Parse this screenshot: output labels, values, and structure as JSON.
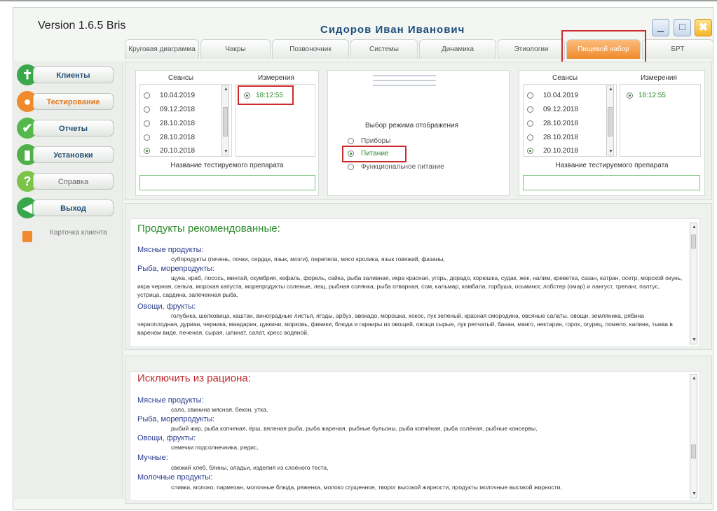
{
  "app": {
    "version": "Version 1.6.5 Bris",
    "user_name": "Сидоров Иван Иванович",
    "window_buttons": {
      "minimize_icon": "minimize-icon",
      "maximize_icon": "maximize-icon",
      "close_icon": "close-icon",
      "close_glyph": "✖"
    }
  },
  "tabs": [
    {
      "label": "Круговая диаграмма",
      "active": false
    },
    {
      "label": "Чакры",
      "active": false
    },
    {
      "label": "Позвоночник",
      "active": false
    },
    {
      "label": "Системы",
      "active": false
    },
    {
      "label": "Динамика",
      "active": false
    },
    {
      "label": "Этиологии",
      "active": false
    },
    {
      "label": "Пищевой набор",
      "active": true
    },
    {
      "label": "БРТ",
      "active": false
    }
  ],
  "sidebar": {
    "items": [
      {
        "label": "Клиенты",
        "icon": "person-icon",
        "icon_color": "#3aa84a",
        "glyph": "✝"
      },
      {
        "label": "Тестирование",
        "icon": "user-icon",
        "icon_color": "#f08a2c",
        "glyph": "●"
      },
      {
        "label": "Отчеты",
        "icon": "checkmark-icon",
        "icon_color": "#55b84a",
        "glyph": "✔"
      },
      {
        "label": "Установки",
        "icon": "chart-icon",
        "icon_color": "#4fb04a",
        "glyph": "▮"
      },
      {
        "label": "Справка",
        "icon": "question-icon",
        "icon_color": "#7cc34a",
        "glyph": "?"
      },
      {
        "label": "Выход",
        "icon": "exit-arrow-icon",
        "icon_color": "#3aa84a",
        "glyph": "◀"
      }
    ],
    "card_label": "Карточка клиента"
  },
  "left_panel": {
    "sessions_header": "Сеансы",
    "measurements_header": "Измерения",
    "sessions": [
      {
        "date": "10.04.2019",
        "selected": false
      },
      {
        "date": "09.12.2018",
        "selected": false
      },
      {
        "date": "28.10.2018",
        "selected": false
      },
      {
        "date": "28.10.2018",
        "selected": false
      },
      {
        "date": "20.10.2018",
        "selected": true
      }
    ],
    "measurement": "18:12:55",
    "drug_caption": "Название тестируемого препарата",
    "drug_value": ""
  },
  "mode_panel": {
    "title": "Выбор режима отображения",
    "options": [
      {
        "label": "Приборы",
        "selected": false
      },
      {
        "label": "Питание",
        "selected": true
      },
      {
        "label": "Функциональное питание",
        "selected": false
      }
    ]
  },
  "right_panel": {
    "sessions_header": "Сеансы",
    "measurements_header": "Измерения",
    "sessions": [
      {
        "date": "10.04.2019",
        "selected": false
      },
      {
        "date": "09.12.2018",
        "selected": false
      },
      {
        "date": "28.10.2018",
        "selected": false
      },
      {
        "date": "28.10.2018",
        "selected": false
      },
      {
        "date": "20.10.2018",
        "selected": true
      }
    ],
    "measurement": "18:12:55",
    "drug_caption": "Название тестируемого препарата",
    "drug_value": ""
  },
  "recommended": {
    "title": "Продукты рекомендованные:",
    "sections": [
      {
        "category": "Мясные продукты:",
        "text": "субпродукты (печень, почки, сердце, язык, мозги), перепела, мясо кролика, язык говяжий, фазаны,"
      },
      {
        "category": "Рыба, морепродукты:",
        "text": "щука, краб, лосось, минтай, скумбрия, кефаль, форель, сайка, рыба заливная, икра красная, угорь, дорадо, корюшка, судак, жек, налим, креветка, сазан, катран, осетр, морской окунь, икра черная, сельга, морская капуста, морепродукты соленые, лещ, рыбная солянка, рыба отварная, сом, кальмар, камбала, горбуша, осьминог, лобстер (омар) и лангуст, трепанг, палтус, устрица, сардина, запеченная рыба,"
      },
      {
        "category": "Овощи, фрукты:",
        "text": "голубика, шелковица, каштан, виноградные листья, ягоды, арбуз, авокадо, морошка, кокос, лук зеленый, красная смородина, овсяные салаты, овощи, земляника, рябина черноплодная, дуриан, черника, мандарин, цуккини, морковь, финики, блюда и гарниры из овощей, овощи сырые, лук репчатый, банан, манго, нектарин, горох, огурец, помело, калина, тыква в вареном виде, печеная, сырая, шпинат, салат, кресс водяной,"
      }
    ]
  },
  "exclude": {
    "title": "Исключить из рациона:",
    "sections": [
      {
        "category": "Мясные продукты:",
        "text": "сало, свинина мясная, бекон, утка,"
      },
      {
        "category": "Рыба, морепродукты:",
        "text": "рыбий жир, рыба копченая, ёрш, вяленая рыба, рыба жареная, рыбные бульоны, рыба копчёная, рыба солёная, рыбные консервы,"
      },
      {
        "category": "Овощи, фрукты:",
        "text": "семечки подсолнечника, редис,"
      },
      {
        "category": "Мучные:",
        "text": "свежий хлеб, блины, оладьи, изделия из слоёного теста,"
      },
      {
        "category": "Молочные продукты:",
        "text": "сливки, молоко, пармезан, молочные блюда, ряженка, молоко сгущенное, творог высокой жирности, продукты молочные высокой жирности,"
      }
    ]
  }
}
